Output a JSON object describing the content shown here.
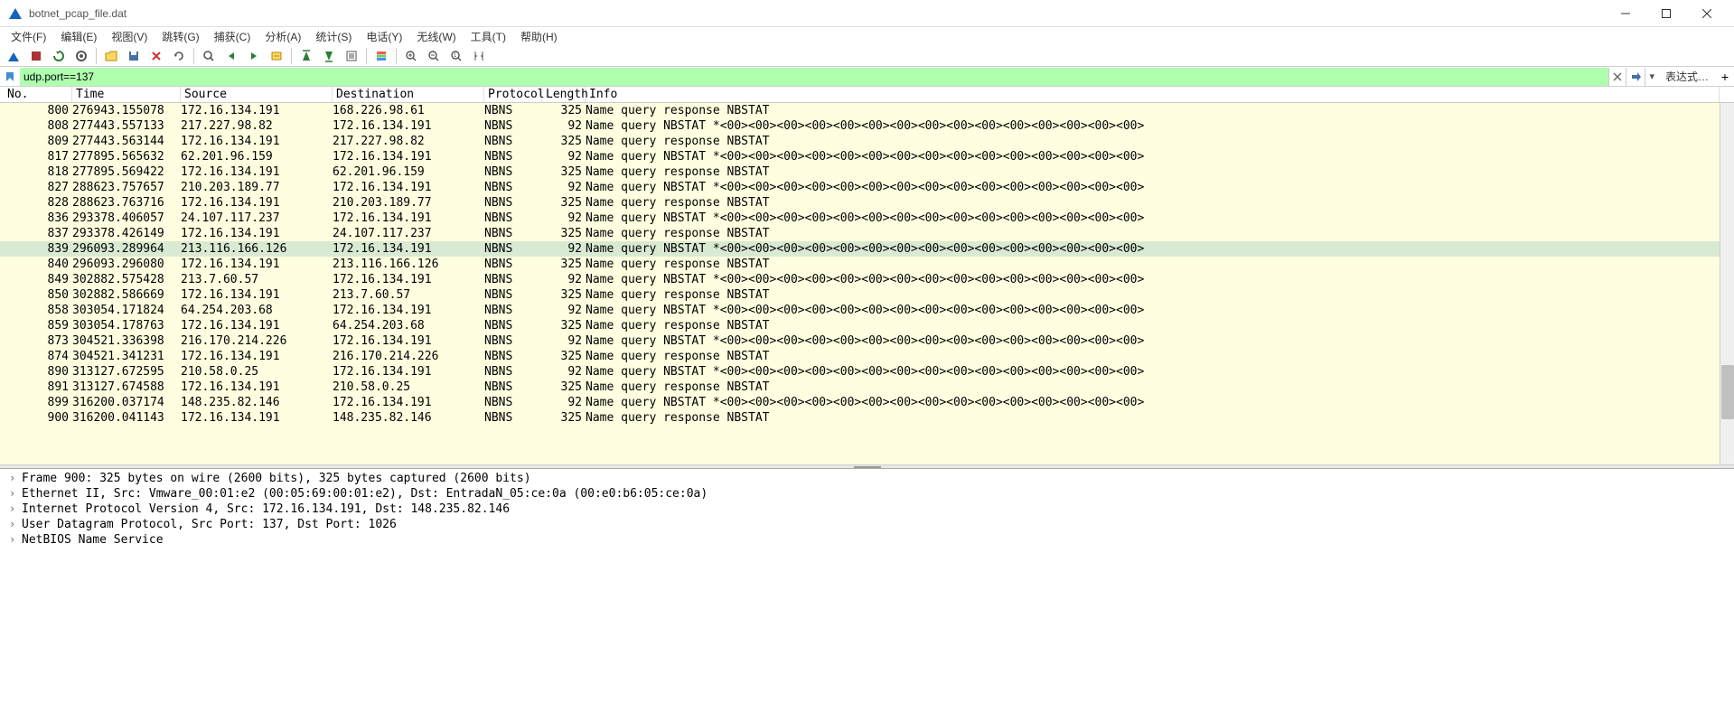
{
  "title": "botnet_pcap_file.dat",
  "menus": [
    "文件(F)",
    "编辑(E)",
    "视图(V)",
    "跳转(G)",
    "捕获(C)",
    "分析(A)",
    "统计(S)",
    "电话(Y)",
    "无线(W)",
    "工具(T)",
    "帮助(H)"
  ],
  "filter": "udp.port==137",
  "expr_label": "表达式…",
  "columns": [
    "No.",
    "Time",
    "Source",
    "Destination",
    "Protocol",
    "Length",
    "Info"
  ],
  "packets": [
    {
      "no": 800,
      "time": "276943.155078",
      "src": "172.16.134.191",
      "dst": "168.226.98.61",
      "proto": "NBNS",
      "len": 325,
      "info": "Name query response NBSTAT"
    },
    {
      "no": 808,
      "time": "277443.557133",
      "src": "217.227.98.82",
      "dst": "172.16.134.191",
      "proto": "NBNS",
      "len": 92,
      "info": "Name query NBSTAT *<00><00><00><00><00><00><00><00><00><00><00><00><00><00><00>"
    },
    {
      "no": 809,
      "time": "277443.563144",
      "src": "172.16.134.191",
      "dst": "217.227.98.82",
      "proto": "NBNS",
      "len": 325,
      "info": "Name query response NBSTAT"
    },
    {
      "no": 817,
      "time": "277895.565632",
      "src": "62.201.96.159",
      "dst": "172.16.134.191",
      "proto": "NBNS",
      "len": 92,
      "info": "Name query NBSTAT *<00><00><00><00><00><00><00><00><00><00><00><00><00><00><00>"
    },
    {
      "no": 818,
      "time": "277895.569422",
      "src": "172.16.134.191",
      "dst": "62.201.96.159",
      "proto": "NBNS",
      "len": 325,
      "info": "Name query response NBSTAT"
    },
    {
      "no": 827,
      "time": "288623.757657",
      "src": "210.203.189.77",
      "dst": "172.16.134.191",
      "proto": "NBNS",
      "len": 92,
      "info": "Name query NBSTAT *<00><00><00><00><00><00><00><00><00><00><00><00><00><00><00>"
    },
    {
      "no": 828,
      "time": "288623.763716",
      "src": "172.16.134.191",
      "dst": "210.203.189.77",
      "proto": "NBNS",
      "len": 325,
      "info": "Name query response NBSTAT"
    },
    {
      "no": 836,
      "time": "293378.406057",
      "src": "24.107.117.237",
      "dst": "172.16.134.191",
      "proto": "NBNS",
      "len": 92,
      "info": "Name query NBSTAT *<00><00><00><00><00><00><00><00><00><00><00><00><00><00><00>"
    },
    {
      "no": 837,
      "time": "293378.426149",
      "src": "172.16.134.191",
      "dst": "24.107.117.237",
      "proto": "NBNS",
      "len": 325,
      "info": "Name query response NBSTAT"
    },
    {
      "no": 839,
      "time": "296093.289964",
      "src": "213.116.166.126",
      "dst": "172.16.134.191",
      "proto": "NBNS",
      "len": 92,
      "info": "Name query NBSTAT *<00><00><00><00><00><00><00><00><00><00><00><00><00><00><00>",
      "sel": true
    },
    {
      "no": 840,
      "time": "296093.296080",
      "src": "172.16.134.191",
      "dst": "213.116.166.126",
      "proto": "NBNS",
      "len": 325,
      "info": "Name query response NBSTAT"
    },
    {
      "no": 849,
      "time": "302882.575428",
      "src": "213.7.60.57",
      "dst": "172.16.134.191",
      "proto": "NBNS",
      "len": 92,
      "info": "Name query NBSTAT *<00><00><00><00><00><00><00><00><00><00><00><00><00><00><00>"
    },
    {
      "no": 850,
      "time": "302882.586669",
      "src": "172.16.134.191",
      "dst": "213.7.60.57",
      "proto": "NBNS",
      "len": 325,
      "info": "Name query response NBSTAT"
    },
    {
      "no": 858,
      "time": "303054.171824",
      "src": "64.254.203.68",
      "dst": "172.16.134.191",
      "proto": "NBNS",
      "len": 92,
      "info": "Name query NBSTAT *<00><00><00><00><00><00><00><00><00><00><00><00><00><00><00>"
    },
    {
      "no": 859,
      "time": "303054.178763",
      "src": "172.16.134.191",
      "dst": "64.254.203.68",
      "proto": "NBNS",
      "len": 325,
      "info": "Name query response NBSTAT"
    },
    {
      "no": 873,
      "time": "304521.336398",
      "src": "216.170.214.226",
      "dst": "172.16.134.191",
      "proto": "NBNS",
      "len": 92,
      "info": "Name query NBSTAT *<00><00><00><00><00><00><00><00><00><00><00><00><00><00><00>"
    },
    {
      "no": 874,
      "time": "304521.341231",
      "src": "172.16.134.191",
      "dst": "216.170.214.226",
      "proto": "NBNS",
      "len": 325,
      "info": "Name query response NBSTAT"
    },
    {
      "no": 890,
      "time": "313127.672595",
      "src": "210.58.0.25",
      "dst": "172.16.134.191",
      "proto": "NBNS",
      "len": 92,
      "info": "Name query NBSTAT *<00><00><00><00><00><00><00><00><00><00><00><00><00><00><00>"
    },
    {
      "no": 891,
      "time": "313127.674588",
      "src": "172.16.134.191",
      "dst": "210.58.0.25",
      "proto": "NBNS",
      "len": 325,
      "info": "Name query response NBSTAT"
    },
    {
      "no": 899,
      "time": "316200.037174",
      "src": "148.235.82.146",
      "dst": "172.16.134.191",
      "proto": "NBNS",
      "len": 92,
      "info": "Name query NBSTAT *<00><00><00><00><00><00><00><00><00><00><00><00><00><00><00>"
    },
    {
      "no": 900,
      "time": "316200.041143",
      "src": "172.16.134.191",
      "dst": "148.235.82.146",
      "proto": "NBNS",
      "len": 325,
      "info": "Name query response NBSTAT"
    }
  ],
  "details": [
    "Frame 900: 325 bytes on wire (2600 bits), 325 bytes captured (2600 bits)",
    "Ethernet II, Src: Vmware_00:01:e2 (00:05:69:00:01:e2), Dst: EntradaN_05:ce:0a (00:e0:b6:05:ce:0a)",
    "Internet Protocol Version 4, Src: 172.16.134.191, Dst: 148.235.82.146",
    "User Datagram Protocol, Src Port: 137, Dst Port: 1026",
    "NetBIOS Name Service"
  ]
}
